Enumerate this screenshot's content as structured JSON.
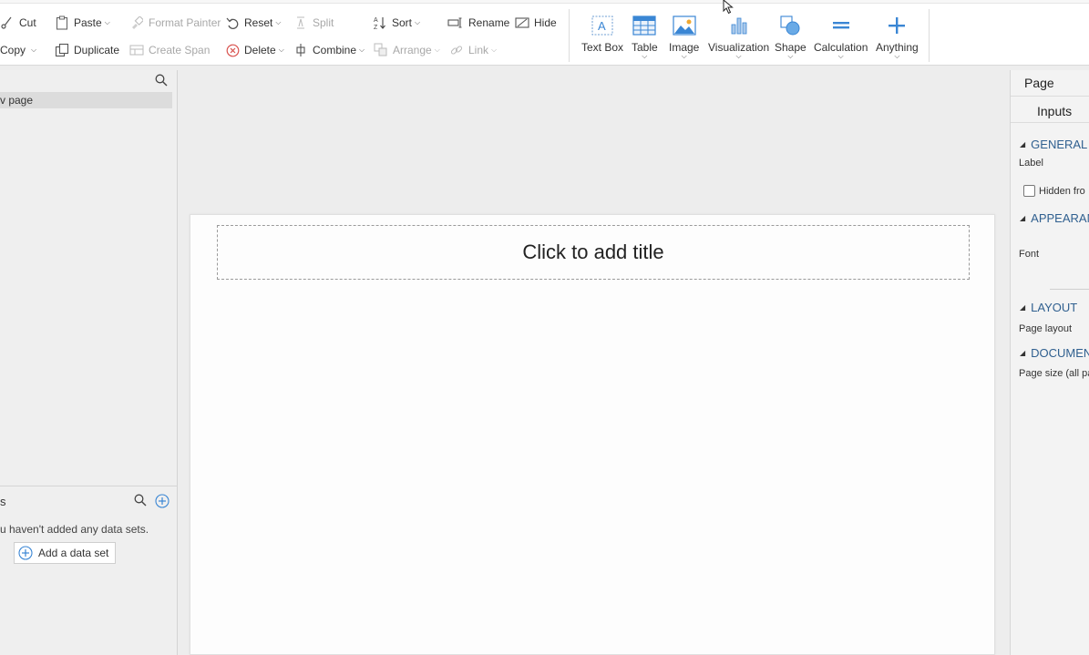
{
  "ribbon": {
    "row1": {
      "cut": "Cut",
      "paste": "Paste",
      "format_painter": "Format Painter",
      "reset": "Reset",
      "split": "Split",
      "sort": "Sort",
      "rename": "Rename",
      "hide": "Hide"
    },
    "row2": {
      "copy": "Copy",
      "duplicate": "Duplicate",
      "create_span": "Create Span",
      "delete": "Delete",
      "combine": "Combine",
      "arrange": "Arrange",
      "link": "Link"
    },
    "insert": {
      "text_box": "Text Box",
      "table": "Table",
      "image": "Image",
      "visualization": "Visualization",
      "shape": "Shape",
      "calculation": "Calculation",
      "anything": "Anything"
    }
  },
  "left_panel": {
    "page_item": "v page",
    "data_sets_title": "s",
    "empty_message": "u haven't added any data sets.",
    "add_data_set": "Add a data set"
  },
  "canvas": {
    "title_placeholder": "Click to add title"
  },
  "right_panel": {
    "tab_page": "Page",
    "tab_inputs": "Inputs",
    "sections": {
      "general": "GENERAL",
      "appearance": "APPEARAN",
      "layout": "LAYOUT",
      "document": "DOCUMEN"
    },
    "props": {
      "label": "Label",
      "hidden_from": "Hidden fro",
      "font": "Font",
      "page_layout": "Page layout",
      "page_size": "Page size (all pa"
    }
  },
  "colors": {
    "accent_blue": "#3a86d4",
    "section_blue": "#2f5f8f",
    "delete_red": "#d9534f"
  }
}
